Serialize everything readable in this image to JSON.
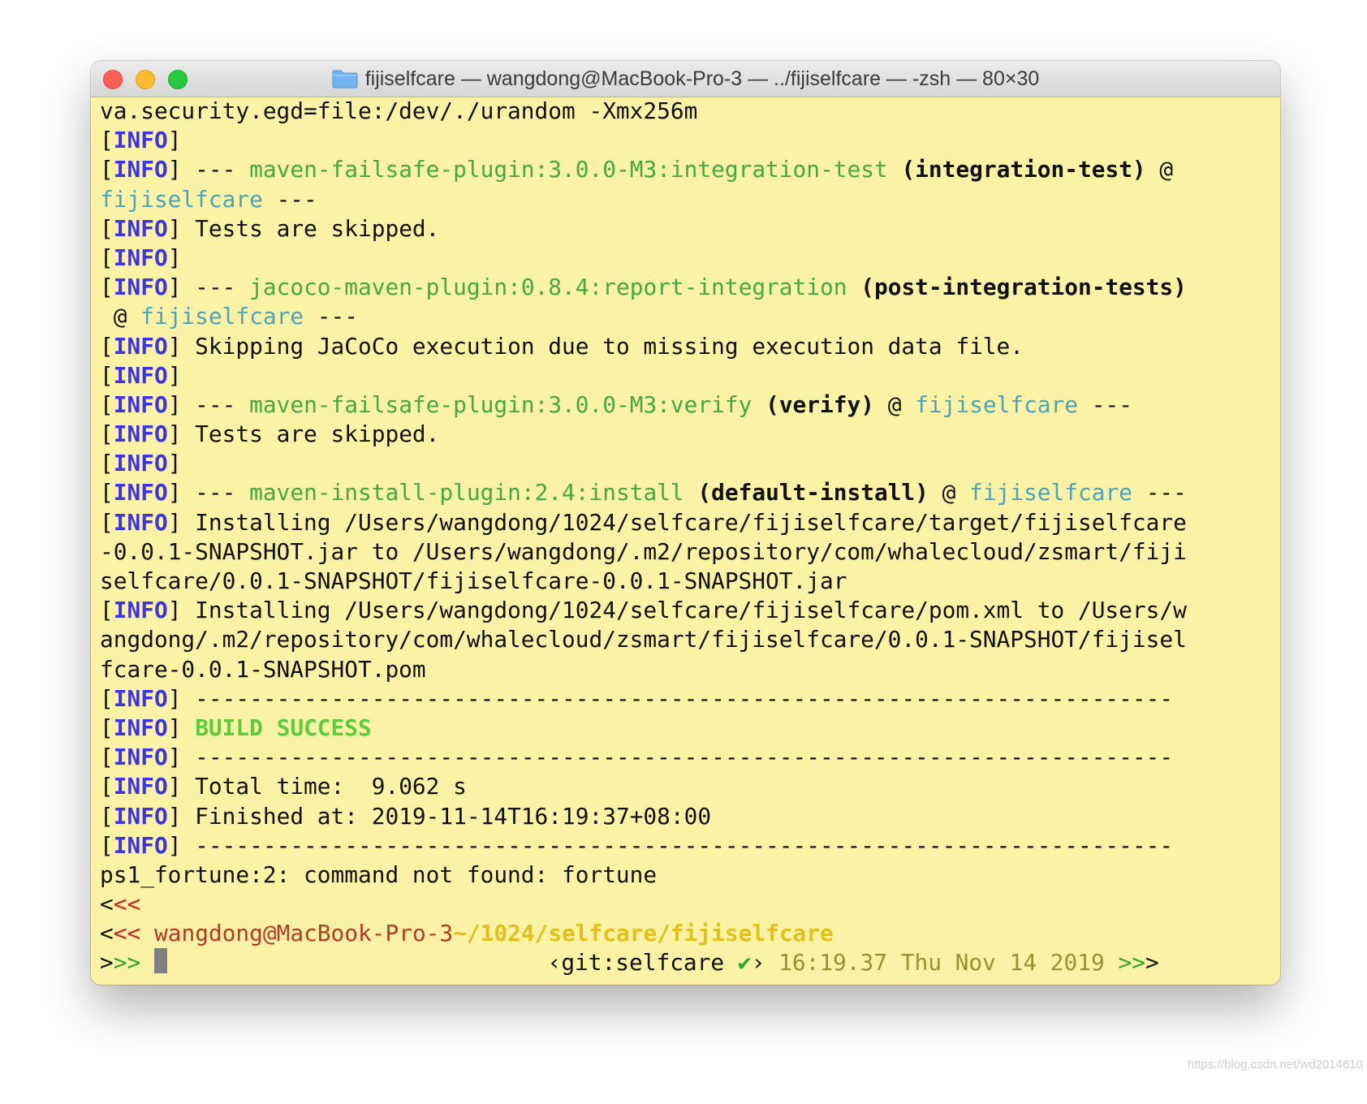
{
  "window": {
    "title": "fijiselfcare — wangdong@MacBook-Pro-3 — ../fijiselfcare — -zsh — 80×30",
    "title_icon": "folder-icon",
    "buttons": [
      "close",
      "minimize",
      "zoom"
    ]
  },
  "colors": {
    "background": "#fbf2a6",
    "info": "#3b34e0",
    "plugin": "#44a844",
    "project": "#4aa3c0",
    "success": "#5bcc3c"
  },
  "terminal": {
    "lines": [
      [
        {
          "t": "va.security.egd=file:/dev/./urandom -Xmx256m"
        }
      ],
      [
        {
          "t": "["
        },
        {
          "t": "INFO",
          "c": "info"
        },
        {
          "t": "]"
        }
      ],
      [
        {
          "t": "["
        },
        {
          "t": "INFO",
          "c": "info"
        },
        {
          "t": "] --- "
        },
        {
          "t": "maven-failsafe-plugin:3.0.0-M3:integration-test",
          "c": "plug"
        },
        {
          "t": " "
        },
        {
          "t": "(integration-test)",
          "c": "bld"
        },
        {
          "t": " @"
        }
      ],
      [
        {
          "t": "fijiselfcare",
          "c": "proj"
        },
        {
          "t": " ---"
        }
      ],
      [
        {
          "t": "["
        },
        {
          "t": "INFO",
          "c": "info"
        },
        {
          "t": "] Tests are skipped."
        }
      ],
      [
        {
          "t": "["
        },
        {
          "t": "INFO",
          "c": "info"
        },
        {
          "t": "]"
        }
      ],
      [
        {
          "t": "["
        },
        {
          "t": "INFO",
          "c": "info"
        },
        {
          "t": "] --- "
        },
        {
          "t": "jacoco-maven-plugin:0.8.4:report-integration",
          "c": "plug"
        },
        {
          "t": " "
        },
        {
          "t": "(post-integration-tests)",
          "c": "bld"
        }
      ],
      [
        {
          "t": " @ "
        },
        {
          "t": "fijiselfcare",
          "c": "proj"
        },
        {
          "t": " ---"
        }
      ],
      [
        {
          "t": "["
        },
        {
          "t": "INFO",
          "c": "info"
        },
        {
          "t": "] Skipping JaCoCo execution due to missing execution data file."
        }
      ],
      [
        {
          "t": "["
        },
        {
          "t": "INFO",
          "c": "info"
        },
        {
          "t": "]"
        }
      ],
      [
        {
          "t": "["
        },
        {
          "t": "INFO",
          "c": "info"
        },
        {
          "t": "] --- "
        },
        {
          "t": "maven-failsafe-plugin:3.0.0-M3:verify",
          "c": "plug"
        },
        {
          "t": " "
        },
        {
          "t": "(verify)",
          "c": "bld"
        },
        {
          "t": " @ "
        },
        {
          "t": "fijiselfcare",
          "c": "proj"
        },
        {
          "t": " ---"
        }
      ],
      [
        {
          "t": "["
        },
        {
          "t": "INFO",
          "c": "info"
        },
        {
          "t": "] Tests are skipped."
        }
      ],
      [
        {
          "t": "["
        },
        {
          "t": "INFO",
          "c": "info"
        },
        {
          "t": "]"
        }
      ],
      [
        {
          "t": "["
        },
        {
          "t": "INFO",
          "c": "info"
        },
        {
          "t": "] --- "
        },
        {
          "t": "maven-install-plugin:2.4:install",
          "c": "plug"
        },
        {
          "t": " "
        },
        {
          "t": "(default-install)",
          "c": "bld"
        },
        {
          "t": " @ "
        },
        {
          "t": "fijiselfcare",
          "c": "proj"
        },
        {
          "t": " ---"
        }
      ],
      [
        {
          "t": "["
        },
        {
          "t": "INFO",
          "c": "info"
        },
        {
          "t": "] Installing /Users/wangdong/1024/selfcare/fijiselfcare/target/fijiselfcare"
        }
      ],
      [
        {
          "t": "-0.0.1-SNAPSHOT.jar to /Users/wangdong/.m2/repository/com/whalecloud/zsmart/fiji"
        }
      ],
      [
        {
          "t": "selfcare/0.0.1-SNAPSHOT/fijiselfcare-0.0.1-SNAPSHOT.jar"
        }
      ],
      [
        {
          "t": "["
        },
        {
          "t": "INFO",
          "c": "info"
        },
        {
          "t": "] Installing /Users/wangdong/1024/selfcare/fijiselfcare/pom.xml to /Users/w"
        }
      ],
      [
        {
          "t": "angdong/.m2/repository/com/whalecloud/zsmart/fijiselfcare/0.0.1-SNAPSHOT/fijisel"
        }
      ],
      [
        {
          "t": "fcare-0.0.1-SNAPSHOT.pom"
        }
      ],
      [
        {
          "t": "["
        },
        {
          "t": "INFO",
          "c": "info"
        },
        {
          "t": "] ------------------------------------------------------------------------"
        }
      ],
      [
        {
          "t": "["
        },
        {
          "t": "INFO",
          "c": "info"
        },
        {
          "t": "] "
        },
        {
          "t": "BUILD SUCCESS",
          "c": "succ"
        }
      ],
      [
        {
          "t": "["
        },
        {
          "t": "INFO",
          "c": "info"
        },
        {
          "t": "] ------------------------------------------------------------------------"
        }
      ],
      [
        {
          "t": "["
        },
        {
          "t": "INFO",
          "c": "info"
        },
        {
          "t": "] Total time:  9.062 s"
        }
      ],
      [
        {
          "t": "["
        },
        {
          "t": "INFO",
          "c": "info"
        },
        {
          "t": "] Finished at: 2019-11-14T16:19:37+08:00"
        }
      ],
      [
        {
          "t": "["
        },
        {
          "t": "INFO",
          "c": "info"
        },
        {
          "t": "] ------------------------------------------------------------------------"
        }
      ],
      [
        {
          "t": "ps1_fortune:2: command not found: fortune"
        }
      ],
      [
        {
          "t": "<"
        },
        {
          "t": "<<",
          "c": "red"
        }
      ],
      [
        {
          "t": "<"
        },
        {
          "t": "<<",
          "c": "red"
        },
        {
          "t": " "
        },
        {
          "t": "wangdong@MacBook-Pro-3",
          "c": "host"
        },
        {
          "t": "~/1024/selfcare/fijiselfcare",
          "c": "path"
        }
      ]
    ],
    "prompt": {
      "prefix": [
        {
          "t": ">"
        },
        {
          "t": ">>",
          "c": "grn"
        },
        {
          "t": " "
        }
      ],
      "right": [
        {
          "t": "‹git:selfcare "
        },
        {
          "t": "✔",
          "c": "grn"
        },
        {
          "t": "› "
        },
        {
          "t": "16:19.37 Thu Nov 14 2019",
          "c": "dim"
        },
        {
          "t": " "
        },
        {
          "t": ">>",
          "c": "grn"
        },
        {
          "t": ">"
        }
      ]
    }
  },
  "watermark": "https://blog.csdn.net/wd2014610"
}
